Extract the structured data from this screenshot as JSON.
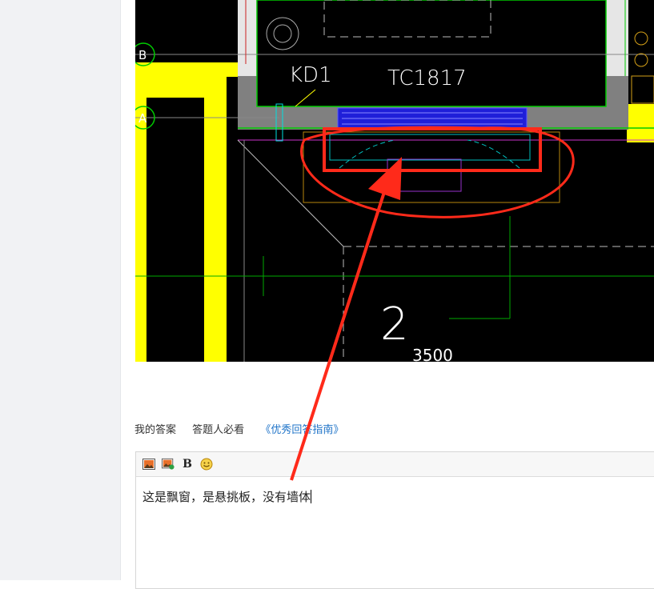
{
  "cad": {
    "grid_b": "B",
    "grid_a": "A",
    "door_tag": "KD1",
    "window_tag": "TC1817",
    "room_no": "2",
    "dim_value": "3500"
  },
  "answer_bar": {
    "my_answer": "我的答案",
    "must_read": "答题人必看",
    "guide_link": "《优秀回答指南》"
  },
  "editor": {
    "toolbar": [
      "image-icon",
      "insert-image-icon",
      "bold-icon",
      "emoji-icon"
    ],
    "bold_label": "B",
    "content": "这是飘窗，是悬挑板，没有墙体"
  },
  "colors": {
    "annotation_red": "#ff2a1a",
    "link_blue": "#1e73c8",
    "cad_yellow": "#ffff00"
  }
}
